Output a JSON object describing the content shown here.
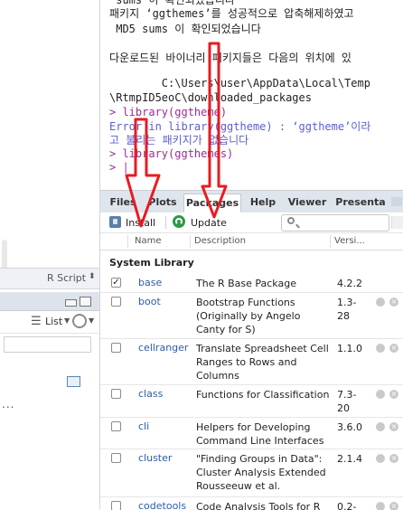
{
  "console": {
    "lines": [
      {
        "text": " sums 이 확인되었습니다",
        "kind": "out"
      },
      {
        "text": "패키지 ‘ggthemes’를 성공적으로 압축해제하였고",
        "kind": "out"
      },
      {
        "text": " MD5 sums 이 확인되었습니다",
        "kind": "out"
      },
      {
        "text": "",
        "kind": "out"
      },
      {
        "text": "다운로드된 바이너리 패키지들은 다음의 위치에 있",
        "kind": "out"
      },
      {
        "text": "        C:\\Users\\user\\AppData\\Local\\Temp",
        "kind": "out"
      },
      {
        "text": "\\RtmpID5eoC\\downloaded_packages",
        "kind": "out"
      },
      {
        "text": "> library(ggtheme)",
        "kind": "cmd"
      },
      {
        "text": "Error in library(ggtheme) : ‘ggtheme’이라",
        "kind": "err"
      },
      {
        "text": "고 불리는 패키지가 없습니다",
        "kind": "err"
      },
      {
        "text": "> library(ggthemes)",
        "kind": "cmd"
      },
      {
        "text": "> |",
        "kind": "cmd"
      }
    ]
  },
  "left_panel": {
    "script_type": "R Script",
    "list_label": "List",
    "dots": "..."
  },
  "tabs": [
    {
      "label": "Files",
      "active": false
    },
    {
      "label": "Plots",
      "active": false
    },
    {
      "label": "Packages",
      "active": true
    },
    {
      "label": "Help",
      "active": false
    },
    {
      "label": "Viewer",
      "active": false
    },
    {
      "label": "Presenta",
      "active": false
    }
  ],
  "toolbar": {
    "install_label": "Install",
    "update_label": "Update",
    "search_placeholder": ""
  },
  "columns": {
    "name": "Name",
    "description": "Description",
    "version": "Versi..."
  },
  "group_label": "System Library",
  "packages": [
    {
      "name": "base",
      "description": "The R Base Package",
      "version": "4.2.2",
      "checked": true
    },
    {
      "name": "boot",
      "description": "Bootstrap Functions (Originally by Angelo Canty for S)",
      "version": "1.3-28",
      "checked": false
    },
    {
      "name": "cellranger",
      "description": "Translate Spreadsheet Cell Ranges to Rows and Columns",
      "version": "1.1.0",
      "checked": false
    },
    {
      "name": "class",
      "description": "Functions for Classification",
      "version": "7.3-20",
      "checked": false
    },
    {
      "name": "cli",
      "description": "Helpers for Developing Command Line Interfaces",
      "version": "3.6.0",
      "checked": false
    },
    {
      "name": "cluster",
      "description": "\"Finding Groups in Data\": Cluster Analysis Extended Rousseeuw et al.",
      "version": "2.1.4",
      "checked": false
    },
    {
      "name": "codetools",
      "description": "Code Analysis Tools for R",
      "version": "0.2-",
      "checked": false
    }
  ],
  "annotation": {
    "arrow_color": "#e81b23"
  }
}
